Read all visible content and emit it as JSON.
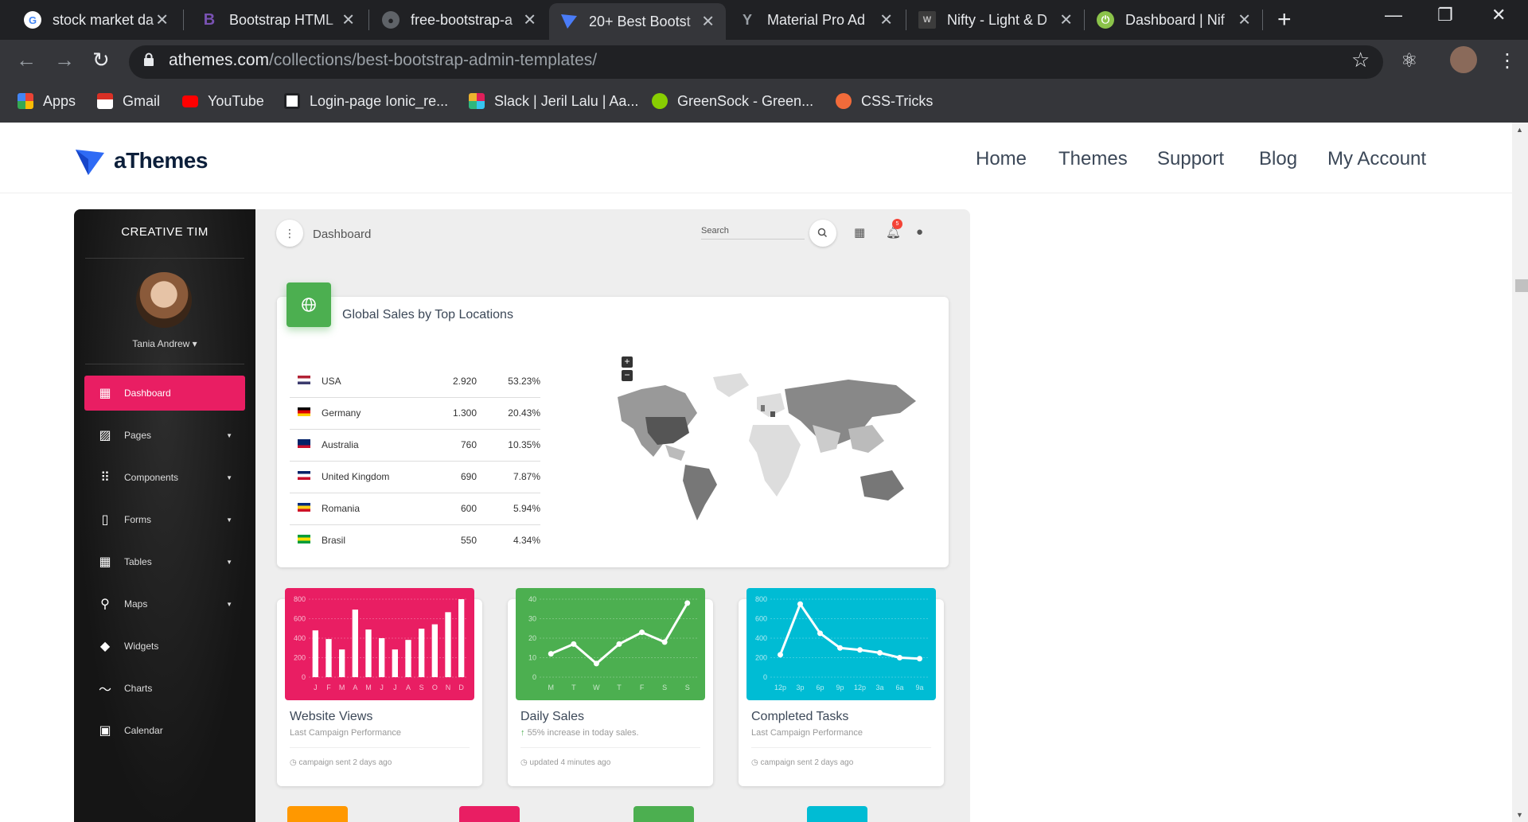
{
  "browser": {
    "tabs": [
      {
        "title": "stock market da",
        "favicon": "google-icon"
      },
      {
        "title": "Bootstrap HTML",
        "favicon": "bootstrap-icon"
      },
      {
        "title": "free-bootstrap-a",
        "favicon": "github-icon"
      },
      {
        "title": "20+ Best Bootst",
        "favicon": "athemes-icon"
      },
      {
        "title": "Material Pro Ad",
        "favicon": "material-pro-icon"
      },
      {
        "title": "Nifty - Light & D",
        "favicon": "nifty-icon"
      },
      {
        "title": "Dashboard | Nif",
        "favicon": "power-icon"
      }
    ],
    "new_tab": "+",
    "url_domain": "athemes.com",
    "url_path": "/collections/best-bootstrap-admin-templates/",
    "bookmarks": [
      {
        "label": "Apps",
        "icon": "apps-grid-icon",
        "color": "#ea4335"
      },
      {
        "label": "Gmail",
        "icon": "gmail-icon",
        "color": "#d93025"
      },
      {
        "label": "YouTube",
        "icon": "youtube-icon",
        "color": "#ff0000"
      },
      {
        "label": "Login-page Ionic_re...",
        "icon": "page-icon",
        "color": "#9aa0a6"
      },
      {
        "label": "Slack | Jeril Lalu | Aa...",
        "icon": "slack-icon",
        "color": "#e01e5a"
      },
      {
        "label": "GreenSock - Green...",
        "icon": "greensock-icon",
        "color": "#88ce02"
      },
      {
        "label": "CSS-Tricks",
        "icon": "css-tricks-icon",
        "color": "#f26b3a"
      }
    ]
  },
  "site": {
    "logo_text": "aThemes",
    "nav": [
      "Home",
      "Themes",
      "Support",
      "Blog",
      "My Account"
    ]
  },
  "dashboard": {
    "brand": "CREATIVE TIM",
    "user_name": "Tania Andrew ▾",
    "breadcrumb": "Dashboard",
    "search_placeholder": "Search",
    "notification_count": "5",
    "sidebar": [
      {
        "label": "Dashboard",
        "icon": "dashboard-icon",
        "active": true
      },
      {
        "label": "Pages",
        "icon": "image-icon",
        "caret": true
      },
      {
        "label": "Components",
        "icon": "apps-icon",
        "caret": true
      },
      {
        "label": "Forms",
        "icon": "clipboard-icon",
        "caret": true
      },
      {
        "label": "Tables",
        "icon": "grid-icon",
        "caret": true
      },
      {
        "label": "Maps",
        "icon": "place-icon",
        "caret": true
      },
      {
        "label": "Widgets",
        "icon": "widgets-icon"
      },
      {
        "label": "Charts",
        "icon": "timeline-icon"
      },
      {
        "label": "Calendar",
        "icon": "date-range-icon"
      }
    ],
    "sales": {
      "title": "Global Sales by Top Locations",
      "rows": [
        {
          "country": "USA",
          "value": "2.920",
          "pct": "53.23%",
          "flag": [
            "#b22234",
            "#fff",
            "#3c3b6e"
          ]
        },
        {
          "country": "Germany",
          "value": "1.300",
          "pct": "20.43%",
          "flag": [
            "#000",
            "#dd0000",
            "#ffce00"
          ]
        },
        {
          "country": "Australia",
          "value": "760",
          "pct": "10.35%",
          "flag": [
            "#012169",
            "#012169",
            "#c8102e"
          ]
        },
        {
          "country": "United Kingdom",
          "value": "690",
          "pct": "7.87%",
          "flag": [
            "#012169",
            "#fff",
            "#c8102e"
          ]
        },
        {
          "country": "Romania",
          "value": "600",
          "pct": "5.94%",
          "flag": [
            "#002b7f",
            "#fcd116",
            "#ce1126"
          ]
        },
        {
          "country": "Brasil",
          "value": "550",
          "pct": "4.34%",
          "flag": [
            "#009c3b",
            "#ffdf00",
            "#009c3b"
          ]
        }
      ],
      "zoom_in": "+",
      "zoom_out": "−"
    },
    "stat_cards": [
      {
        "title": "Website Views",
        "subtitle": "Last Campaign Performance",
        "footer": "campaign sent 2 days ago",
        "color": "#e91e63",
        "chart": "bar"
      },
      {
        "title": "Daily Sales",
        "subtitle": "55% increase in today sales.",
        "highlight": "↑ 55%",
        "footer": "updated 4 minutes ago",
        "color": "#4caf50",
        "chart": "line"
      },
      {
        "title": "Completed Tasks",
        "subtitle": "Last Campaign Performance",
        "footer": "campaign sent 2 days ago",
        "color": "#00bcd4",
        "chart": "line"
      }
    ],
    "bottom_tiles": [
      "#ff9800",
      "#e91e63",
      "#4caf50",
      "#00bcd4"
    ]
  },
  "chart_data": [
    {
      "type": "bar",
      "categories": [
        "J",
        "F",
        "M",
        "A",
        "M",
        "J",
        "J",
        "A",
        "S",
        "O",
        "N",
        "D"
      ],
      "values": [
        540,
        440,
        320,
        780,
        550,
        450,
        320,
        430,
        560,
        610,
        750,
        900
      ],
      "ylim": [
        0,
        900
      ],
      "yticks": [
        "800",
        "600",
        "400",
        "200",
        "0"
      ]
    },
    {
      "type": "line",
      "categories": [
        "M",
        "T",
        "W",
        "T",
        "F",
        "S",
        "S"
      ],
      "values": [
        12,
        17,
        7,
        17,
        23,
        18,
        38
      ],
      "ylim": [
        0,
        40
      ],
      "yticks": [
        "40",
        "30",
        "20",
        "10",
        "0"
      ]
    },
    {
      "type": "line",
      "categories": [
        "12p",
        "3p",
        "6p",
        "9p",
        "12p",
        "3a",
        "6a",
        "9a"
      ],
      "values": [
        230,
        750,
        450,
        300,
        280,
        250,
        200,
        190
      ],
      "ylim": [
        0,
        800
      ],
      "yticks": [
        "800",
        "600",
        "400",
        "200",
        "0"
      ]
    }
  ]
}
